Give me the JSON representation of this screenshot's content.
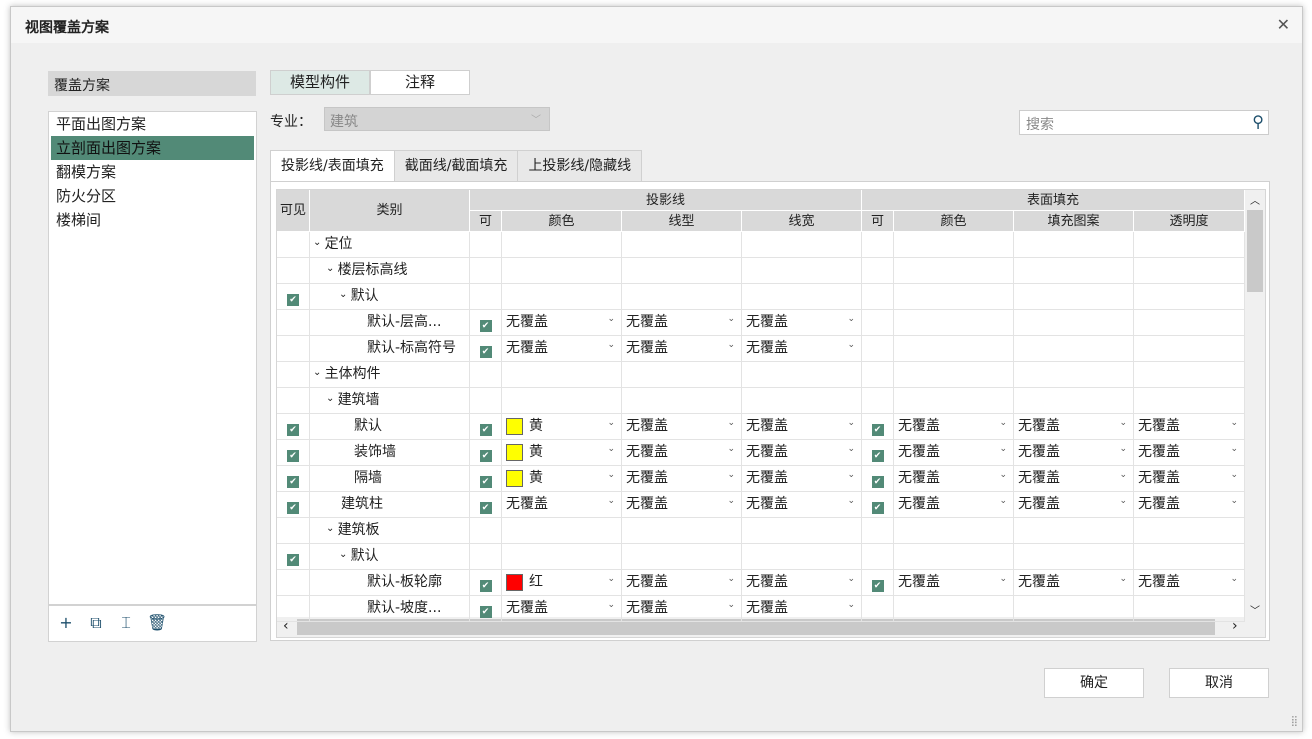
{
  "title": "视图覆盖方案",
  "left": {
    "header": "覆盖方案",
    "items": [
      "平面出图方案",
      "立剖面出图方案",
      "翻模方案",
      "防火分区",
      "楼梯间"
    ],
    "selected": 1,
    "tools": [
      {
        "icon": "add-icon",
        "glyph": "+"
      },
      {
        "icon": "duplicate-icon",
        "glyph": "⧉"
      },
      {
        "icon": "rename-icon",
        "glyph": "⌶"
      },
      {
        "icon": "delete-icon",
        "glyph": "🗑"
      }
    ]
  },
  "segments": [
    "模型构件",
    "注释"
  ],
  "specialty": {
    "label": "专业：",
    "value": "建筑"
  },
  "search": {
    "placeholder": "搜索"
  },
  "tabs": [
    "投影线/表面填充",
    "截面线/截面填充",
    "上投影线/隐藏线"
  ],
  "headers": {
    "visible": "可见",
    "category": "类别",
    "proj": "投影线",
    "surf": "表面填充",
    "cols": [
      "可",
      "颜色",
      "线型",
      "线宽",
      "可",
      "颜色",
      "填充图案",
      "透明度"
    ]
  },
  "colors": {
    "黄": "#ffff00",
    "红": "#ff0000"
  },
  "rows": [
    {
      "name": "定位",
      "level": 0,
      "exp": true
    },
    {
      "name": "楼层标高线",
      "level": 1,
      "exp": true
    },
    {
      "name": "默认",
      "level": 2,
      "exp": true,
      "vis": true
    },
    {
      "name": "默认-层高...",
      "level": 3,
      "pc": true,
      "p": [
        "无覆盖",
        "无覆盖",
        "无覆盖"
      ]
    },
    {
      "name": "默认-标高符号",
      "level": 3,
      "pc": true,
      "p": [
        "无覆盖",
        "无覆盖",
        "无覆盖"
      ]
    },
    {
      "name": "主体构件",
      "level": 0,
      "exp": true
    },
    {
      "name": "建筑墙",
      "level": 1,
      "exp": true
    },
    {
      "name": "默认",
      "level": 2,
      "vis": true,
      "pc": true,
      "p": [
        "黄",
        "无覆盖",
        "无覆盖"
      ],
      "sc": true,
      "s": [
        "无覆盖",
        "无覆盖",
        "无覆盖"
      ]
    },
    {
      "name": "装饰墙",
      "level": 2,
      "vis": true,
      "pc": true,
      "p": [
        "黄",
        "无覆盖",
        "无覆盖"
      ],
      "sc": true,
      "s": [
        "无覆盖",
        "无覆盖",
        "无覆盖"
      ]
    },
    {
      "name": "隔墙",
      "level": 2,
      "vis": true,
      "pc": true,
      "p": [
        "黄",
        "无覆盖",
        "无覆盖"
      ],
      "sc": true,
      "s": [
        "无覆盖",
        "无覆盖",
        "无覆盖"
      ]
    },
    {
      "name": "建筑柱",
      "level": 1,
      "vis": true,
      "pc": true,
      "p": [
        "无覆盖",
        "无覆盖",
        "无覆盖"
      ],
      "sc": true,
      "s": [
        "无覆盖",
        "无覆盖",
        "无覆盖"
      ]
    },
    {
      "name": "建筑板",
      "level": 1,
      "exp": true
    },
    {
      "name": "默认",
      "level": 2,
      "exp": true,
      "vis": true
    },
    {
      "name": "默认-板轮廓",
      "level": 3,
      "pc": true,
      "p": [
        "红",
        "无覆盖",
        "无覆盖"
      ],
      "sc": true,
      "s": [
        "无覆盖",
        "无覆盖",
        "无覆盖"
      ]
    },
    {
      "name": "默认-坡度...",
      "level": 3,
      "pc": true,
      "p": [
        "无覆盖",
        "无覆盖",
        "无覆盖"
      ]
    }
  ],
  "buttons": {
    "ok": "确定",
    "cancel": "取消"
  }
}
